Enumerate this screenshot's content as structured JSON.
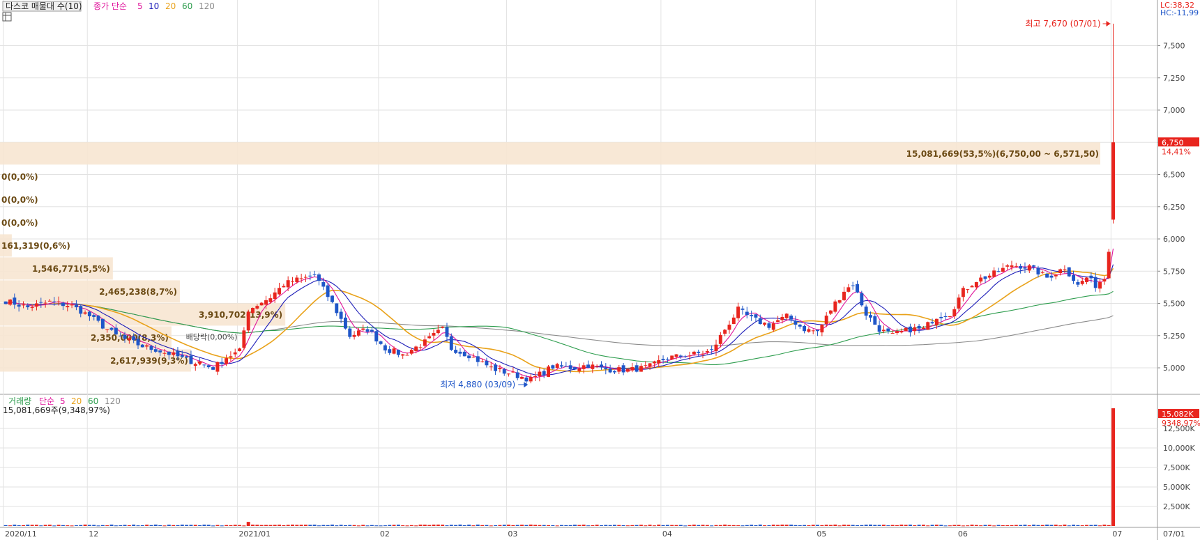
{
  "legend": {
    "title": "다스코 매물대 수(10)",
    "ma_label": "종가 단순",
    "ma_periods": [
      "5",
      "10",
      "20",
      "60",
      "120"
    ],
    "volume_title": "거래량",
    "volume_ma_label": "단순",
    "volume_ma_periods": [
      "5",
      "20",
      "60",
      "120"
    ],
    "volume_info": "15,081,669주(9,348,97%)"
  },
  "indicators": {
    "lc": "LC:38,32",
    "hc": "HC:-11,99"
  },
  "colors": {
    "up": "#e8251e",
    "down": "#1f56c8",
    "ma5": "#e0169c",
    "ma10": "#1d1db8",
    "ma20": "#e9a21a",
    "ma60": "#2e9d4e",
    "ma120": "#8c8c8c",
    "band": "#f7e6d2",
    "band_text": "#6b4a14",
    "grid": "#e2e2e2"
  },
  "chart_data": {
    "type": "candlestick",
    "price_axis": {
      "range": [
        4800,
        7800
      ],
      "ticks": [
        5000,
        5250,
        5500,
        5750,
        6000,
        6250,
        6500,
        6750,
        7000,
        7250,
        7500
      ],
      "tick_labels": [
        "5,000",
        "5,250",
        "5,500",
        "5,750",
        "6,000",
        "6,250",
        "6,500",
        "6,750",
        "7,000",
        "7,250",
        "7,500"
      ]
    },
    "volume_axis": {
      "range": [
        0,
        15800000
      ],
      "ticks": [
        2500000,
        5000000,
        7500000,
        10000000,
        12500000
      ],
      "tick_labels": [
        "2,500K",
        "5,000K",
        "7,500K",
        "10,000K",
        "12,500K"
      ]
    },
    "time_axis": {
      "labels": [
        "2020/11",
        "12",
        "2021/01",
        "02",
        "03",
        "04",
        "05",
        "06",
        "07"
      ],
      "label_index": [
        0,
        19,
        53,
        85,
        114,
        149,
        184,
        216,
        251
      ],
      "next_label": "07/01"
    },
    "last_price": {
      "label": "6,750",
      "value": 6750,
      "change": "14,41%"
    },
    "last_volume": {
      "label": "15,082K",
      "change": "9348,97%"
    },
    "annotations": {
      "high": {
        "label": "최고 7,670 (07/01)",
        "value": 7670,
        "index": 251
      },
      "low": {
        "label": "최저 4,880 (03/09)",
        "value": 4880,
        "index": 119
      },
      "dividend": {
        "label": "배당락(0,00%)",
        "index": 44
      }
    },
    "volume_profile": [
      {
        "range": [
          6571.5,
          6750
        ],
        "volume": 15081669,
        "label": "15,081,669(53,5%)(6,750,00 ~ 6,571,50)"
      },
      {
        "range": [
          6393,
          6571.5
        ],
        "volume": 0,
        "label": "0(0,0%)"
      },
      {
        "range": [
          6214.5,
          6393
        ],
        "volume": 0,
        "label": "0(0,0%)"
      },
      {
        "range": [
          6036,
          6214.5
        ],
        "volume": 0,
        "label": "0(0,0%)"
      },
      {
        "range": [
          5857.5,
          6036
        ],
        "volume": 161319,
        "label": "161,319(0,6%)"
      },
      {
        "range": [
          5679,
          5857.5
        ],
        "volume": 1546771,
        "label": "1,546,771(5,5%)"
      },
      {
        "range": [
          5500.5,
          5679
        ],
        "volume": 2465238,
        "label": "2,465,238(8,7%)"
      },
      {
        "range": [
          5322,
          5500.5
        ],
        "volume": 3910702,
        "label": "3,910,702(13,9%)"
      },
      {
        "range": [
          5143.5,
          5322
        ],
        "volume": 2350000,
        "label": "2,350,000(8,3%)"
      },
      {
        "range": [
          4965,
          5143.5
        ],
        "volume": 2617939,
        "label": "2,617,939(9,3%)"
      }
    ],
    "candles": [],
    "volume_series": [],
    "ma_series": {
      "5": [],
      "10": [],
      "20": [],
      "60": [],
      "120": []
    },
    "close_path": [
      [
        0,
        5520
      ],
      [
        5,
        5470
      ],
      [
        10,
        5510
      ],
      [
        15,
        5480
      ],
      [
        19,
        5400
      ],
      [
        25,
        5250
      ],
      [
        30,
        5180
      ],
      [
        36,
        5120
      ],
      [
        42,
        5050
      ],
      [
        47,
        5000
      ],
      [
        50,
        5080
      ],
      [
        53,
        5130
      ],
      [
        55,
        5450
      ],
      [
        60,
        5550
      ],
      [
        63,
        5650
      ],
      [
        66,
        5680
      ],
      [
        70,
        5720
      ],
      [
        74,
        5500
      ],
      [
        78,
        5250
      ],
      [
        82,
        5300
      ],
      [
        86,
        5150
      ],
      [
        90,
        5100
      ],
      [
        95,
        5200
      ],
      [
        99,
        5300
      ],
      [
        101,
        5150
      ],
      [
        105,
        5100
      ],
      [
        110,
        5000
      ],
      [
        115,
        4950
      ],
      [
        119,
        4910
      ],
      [
        124,
        5010
      ],
      [
        128,
        5000
      ],
      [
        132,
        5020
      ],
      [
        136,
        4990
      ],
      [
        141,
        4980
      ],
      [
        146,
        5010
      ],
      [
        150,
        5080
      ],
      [
        155,
        5100
      ],
      [
        160,
        5130
      ],
      [
        163,
        5300
      ],
      [
        166,
        5450
      ],
      [
        169,
        5380
      ],
      [
        173,
        5330
      ],
      [
        177,
        5400
      ],
      [
        181,
        5300
      ],
      [
        184,
        5280
      ],
      [
        187,
        5450
      ],
      [
        190,
        5600
      ],
      [
        192,
        5650
      ],
      [
        195,
        5420
      ],
      [
        198,
        5300
      ],
      [
        201,
        5250
      ],
      [
        205,
        5300
      ],
      [
        208,
        5300
      ],
      [
        211,
        5400
      ],
      [
        214,
        5420
      ],
      [
        217,
        5600
      ],
      [
        220,
        5680
      ],
      [
        224,
        5730
      ],
      [
        228,
        5800
      ],
      [
        232,
        5780
      ],
      [
        236,
        5700
      ],
      [
        240,
        5780
      ],
      [
        243,
        5640
      ],
      [
        245,
        5700
      ],
      [
        247,
        5640
      ],
      [
        249,
        5700
      ],
      [
        250,
        5900
      ],
      [
        251,
        6750
      ]
    ],
    "volume_level": {
      "typical_max": 400000
    }
  }
}
